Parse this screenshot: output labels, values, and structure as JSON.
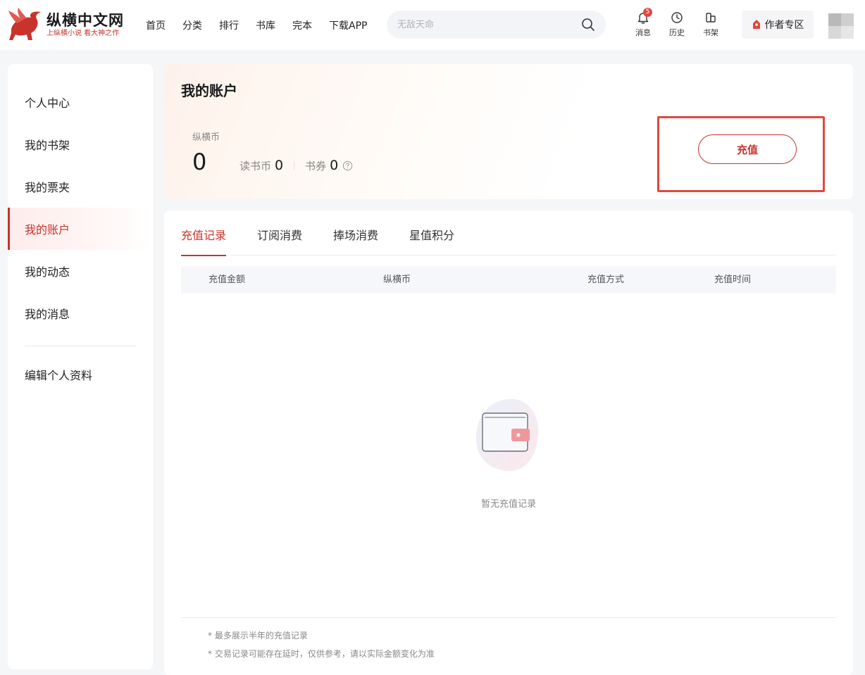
{
  "header": {
    "logo": {
      "title": "纵横中文网",
      "slogan": "上纵横小说  看大神之作"
    },
    "nav": [
      "首页",
      "分类",
      "排行",
      "书库",
      "完本",
      "下载APP"
    ],
    "search": {
      "placeholder": "无敌天命",
      "icon": "search-icon"
    },
    "icons": [
      {
        "label": "消息",
        "icon": "bell-icon",
        "badge": "5"
      },
      {
        "label": "历史",
        "icon": "clock-icon"
      },
      {
        "label": "书架",
        "icon": "bookshelf-icon"
      }
    ],
    "author_zone": {
      "label": "作者专区",
      "icon": "author-pen-icon"
    },
    "accent_color": "#c8332b"
  },
  "sidebar": {
    "items": [
      "个人中心",
      "我的书架",
      "我的票夹",
      "我的账户",
      "我的动态",
      "我的消息"
    ],
    "active": "我的账户",
    "edit_profile": "编辑个人资料"
  },
  "account": {
    "title": "我的账户",
    "coin_label": "纵横币",
    "coin_value": "0",
    "reading_coin_label": "读书币",
    "reading_coin_value": "0",
    "voucher_label": "书券",
    "voucher_value": "0",
    "recharge_label": "充值"
  },
  "records": {
    "tabs": [
      "充值记录",
      "订阅消费",
      "捧场消费",
      "星值积分"
    ],
    "active_tab": "充值记录",
    "columns": [
      "充值金额",
      "纵横币",
      "充值方式",
      "充值时间"
    ],
    "empty_text": "暂无充值记录",
    "notes": [
      "* 最多展示半年的充值记录",
      "* 交易记录可能存在延时，仅供参考，请以实际金额变化为准"
    ]
  }
}
